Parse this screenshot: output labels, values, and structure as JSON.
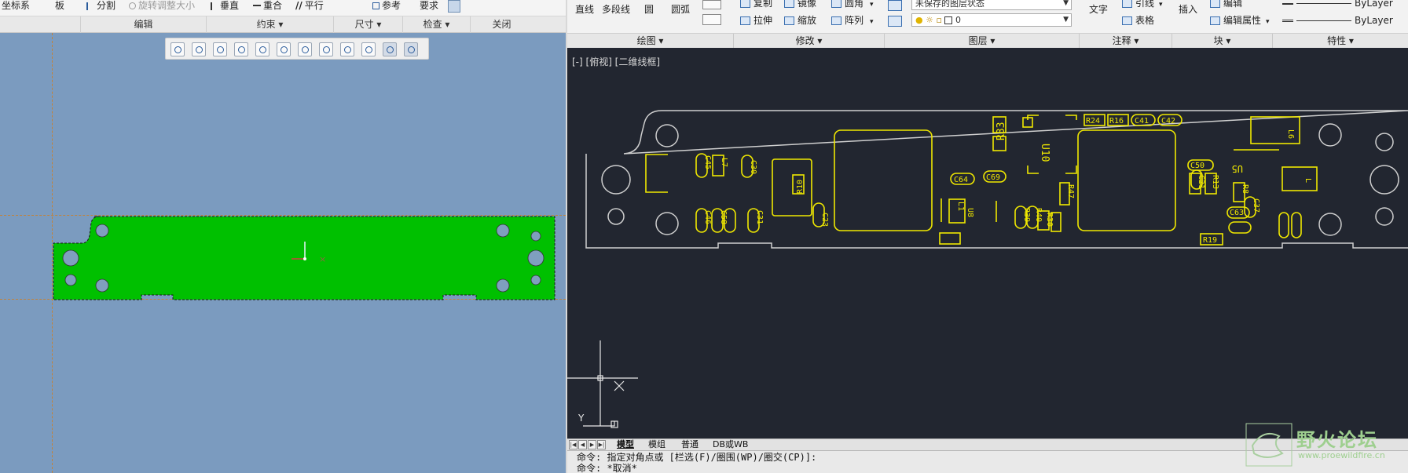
{
  "creo": {
    "ribbon": {
      "coord_label": "坐标系",
      "board_label": "板",
      "split_label": "分割",
      "rotate_resize_label": "旋转调整大小",
      "vertical_label": "垂直",
      "coincident_label": "重合",
      "parallel_label": "平行",
      "reference_label": "参考",
      "requirement_label": "要求"
    },
    "groups": {
      "edit": "编辑",
      "constraint": "约束 ▾",
      "dimension": "尺寸 ▾",
      "inspect": "检查 ▾",
      "close": "关闭"
    },
    "view_toolbar": [
      "refit-icon",
      "zoom-in-icon",
      "zoom-out-icon",
      "repaint-icon",
      "view-orient-icon",
      "saved-views-icon",
      "display-style-icon",
      "datum-display-icon",
      "spin-center-icon",
      "constraint-display-icon",
      "dimension-display-icon",
      "vertex-display-icon"
    ],
    "colors": {
      "background": "#7b9bbf",
      "board_fill": "#00c000",
      "board_edge": "#1a1a1a",
      "hole": "#7f9fbf"
    }
  },
  "autocad": {
    "ribbon": {
      "line": "直线",
      "polyline": "多段线",
      "circle": "圆",
      "arc": "圆弧",
      "move": "复制",
      "mirror": "镜像",
      "fillet": "圆角",
      "stretch": "拉伸",
      "scale": "缩放",
      "array": "阵列",
      "layer_state": "未保存的图层状态",
      "layer_name": "0",
      "text": "文字",
      "leader": "引线",
      "table": "表格",
      "insert": "插入",
      "edit": "编辑",
      "edit_attr": "编辑属性",
      "bylayer1": "ByLayer",
      "bylayer2": "ByLayer"
    },
    "groups": {
      "draw": "绘图 ▾",
      "modify": "修改 ▾",
      "layer": "图层 ▾",
      "annotation": "注释 ▾",
      "block": "块 ▾",
      "properties": "特性 ▾"
    },
    "viewport_label": "[-] [俯视] [二维线框]",
    "pcb_labels": [
      "R33",
      "U10",
      "U5",
      "R10",
      "C30",
      "R24",
      "R16",
      "C41",
      "C42",
      "C64",
      "C69",
      "C23",
      "C50",
      "R13",
      "R47",
      "R39",
      "R40",
      "R30",
      "R8",
      "C63",
      "C37",
      "C45",
      "C46",
      "C58",
      "C31",
      "L1",
      "L6",
      "L7",
      "U8",
      "C21",
      "R19"
    ],
    "ucs_y": "Y",
    "tabs": [
      "模型",
      "模组",
      "普通",
      "DB或WB"
    ],
    "command_lines": [
      "命令: 指定对角点或 [栏选(F)/圈围(WP)/圈交(CP)]:",
      "命令: *取消*"
    ],
    "colors": {
      "background": "#222630",
      "outline": "#cfcfcf",
      "components": "#f0e800"
    }
  },
  "watermark": {
    "title": "野火论坛",
    "url": "www.proewildfire.cn"
  }
}
